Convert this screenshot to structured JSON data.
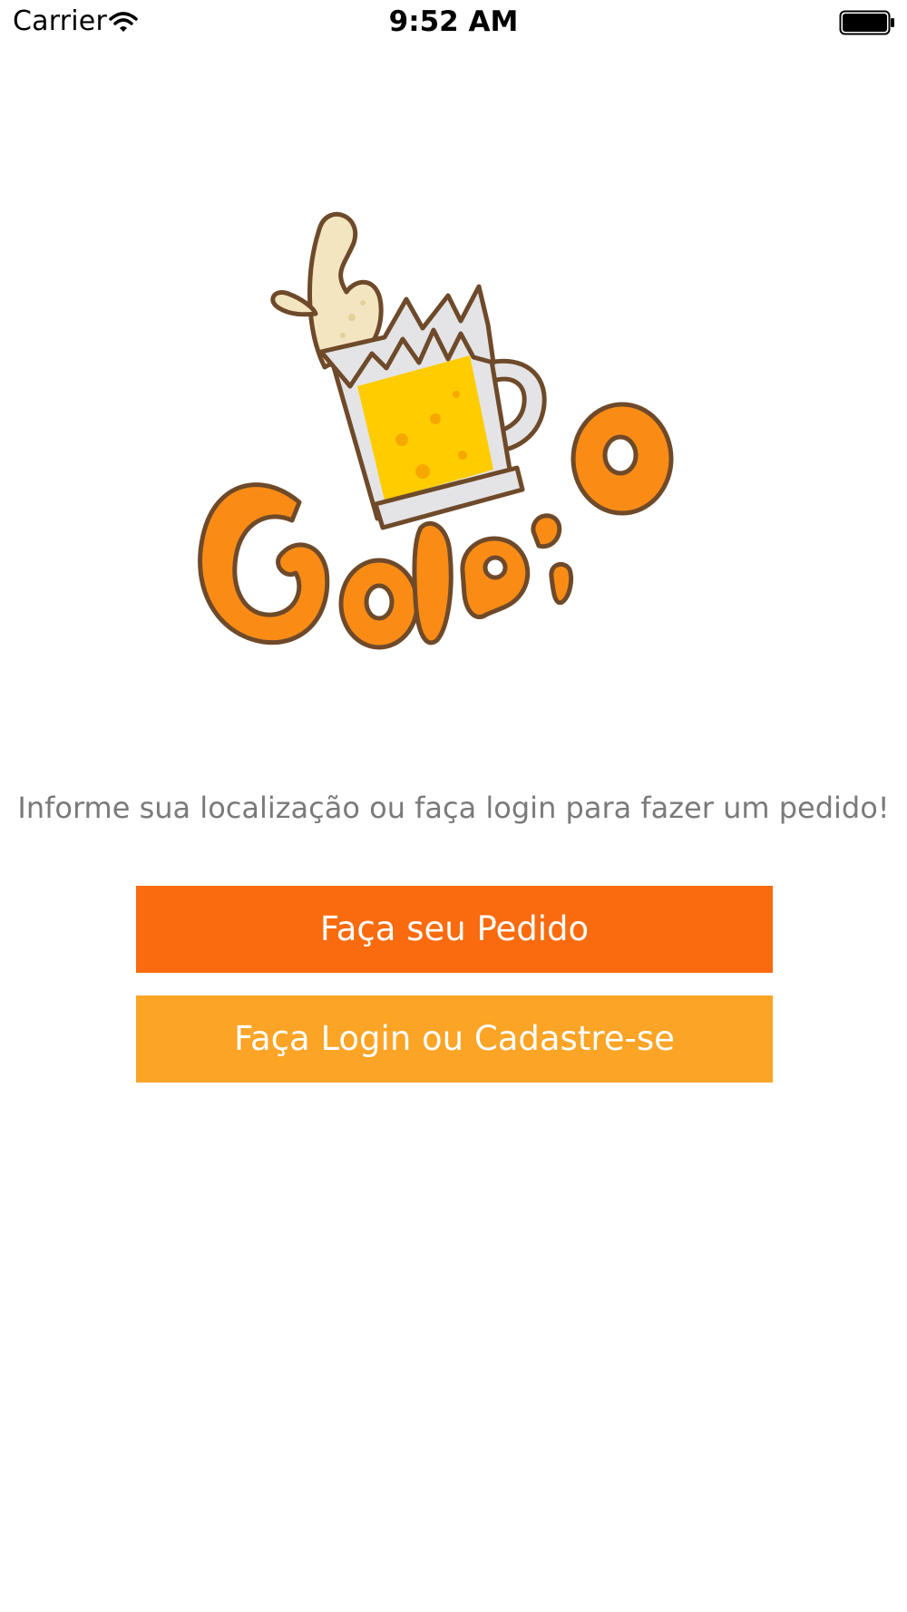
{
  "status_bar": {
    "carrier": "Carrier",
    "time": "9:52 AM",
    "icons": [
      "wifi-icon",
      "battery-icon"
    ]
  },
  "logo": {
    "icon": "beer-mug-logo",
    "wordmark": "Golaço",
    "colors": {
      "orange": "#fa8c16",
      "outline": "#6e4a2a",
      "beer": "#ffcc00",
      "foam": "#f3e5c0",
      "glass": "#e4e4e6"
    }
  },
  "main": {
    "instruction": "Informe sua localização ou faça login para fazer um pedido!",
    "order_button_label": "Faça seu Pedido",
    "login_button_label": "Faça Login ou Cadastre-se"
  },
  "colors": {
    "order_button": "#f96b0e",
    "login_button": "#fba426",
    "instruction_text": "#7a7a7a"
  }
}
